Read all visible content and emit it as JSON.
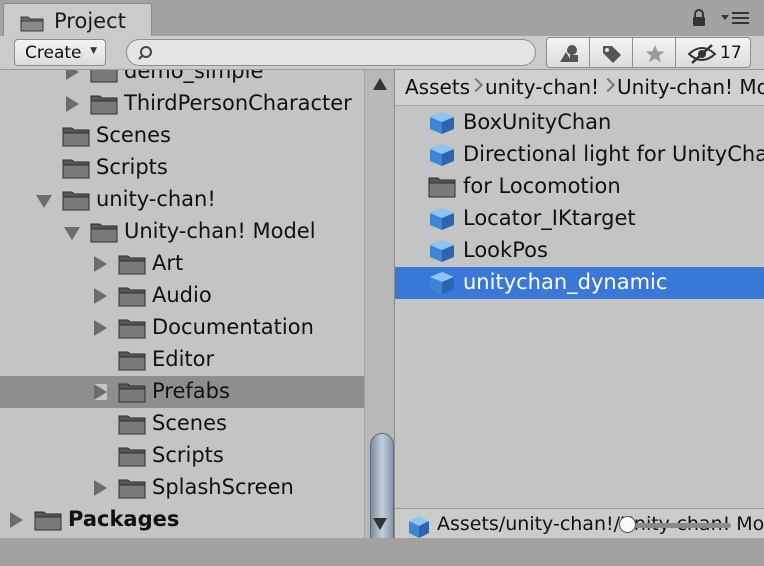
{
  "tab": {
    "title": "Project"
  },
  "toolbar": {
    "create_label": "Create",
    "search_value": "",
    "hidden_count": "17"
  },
  "tree": {
    "rows": [
      {
        "label": "demo_simple",
        "depth": 3,
        "arrow": "right",
        "selected": false,
        "bold": false
      },
      {
        "label": "ThirdPersonCharacter",
        "depth": 3,
        "arrow": "right",
        "selected": false,
        "bold": false
      },
      {
        "label": "Scenes",
        "depth": 2,
        "arrow": "none",
        "selected": false,
        "bold": false
      },
      {
        "label": "Scripts",
        "depth": 2,
        "arrow": "none",
        "selected": false,
        "bold": false
      },
      {
        "label": "unity-chan!",
        "depth": 2,
        "arrow": "down",
        "selected": false,
        "bold": false
      },
      {
        "label": "Unity-chan! Model",
        "depth": 3,
        "arrow": "down",
        "selected": false,
        "bold": false
      },
      {
        "label": "Art",
        "depth": 4,
        "arrow": "right",
        "selected": false,
        "bold": false
      },
      {
        "label": "Audio",
        "depth": 4,
        "arrow": "right",
        "selected": false,
        "bold": false
      },
      {
        "label": "Documentation",
        "depth": 4,
        "arrow": "right",
        "selected": false,
        "bold": false
      },
      {
        "label": "Editor",
        "depth": 4,
        "arrow": "none",
        "selected": false,
        "bold": false
      },
      {
        "label": "Prefabs",
        "depth": 4,
        "arrow": "right",
        "selected": true,
        "bold": false
      },
      {
        "label": "Scenes",
        "depth": 4,
        "arrow": "none",
        "selected": false,
        "bold": false
      },
      {
        "label": "Scripts",
        "depth": 4,
        "arrow": "none",
        "selected": false,
        "bold": false
      },
      {
        "label": "SplashScreen",
        "depth": 4,
        "arrow": "right",
        "selected": false,
        "bold": false
      },
      {
        "label": "Packages",
        "depth": 1,
        "arrow": "right",
        "selected": false,
        "bold": true
      }
    ],
    "scroll_fraction": 0.55
  },
  "breadcrumb": [
    "Assets",
    "unity-chan!",
    "Unity-chan! Model"
  ],
  "assets": [
    {
      "label": "BoxUnityChan",
      "icon": "prefab-cube-icon",
      "selected": false
    },
    {
      "label": "Directional light for UnityChan",
      "icon": "prefab-cube-icon",
      "selected": false
    },
    {
      "label": "for Locomotion",
      "icon": "folder-icon",
      "selected": false
    },
    {
      "label": "Locator_IKtarget",
      "icon": "prefab-cube-icon",
      "selected": false
    },
    {
      "label": "LookPos",
      "icon": "prefab-cube-icon",
      "selected": false
    },
    {
      "label": "unitychan_dynamic",
      "icon": "prefab-cube-icon",
      "selected": true
    }
  ],
  "bottom": {
    "path": "Assets/unity-chan!/Unity-chan! Model/Prefabs/unitychan_dynamic.prefab",
    "zoom_fraction": 0.0
  },
  "colors": {
    "selection_blue": "#3a78d8",
    "tree_selection_gray": "#8e8e8e",
    "panel_bg": "#c4c4c4"
  }
}
